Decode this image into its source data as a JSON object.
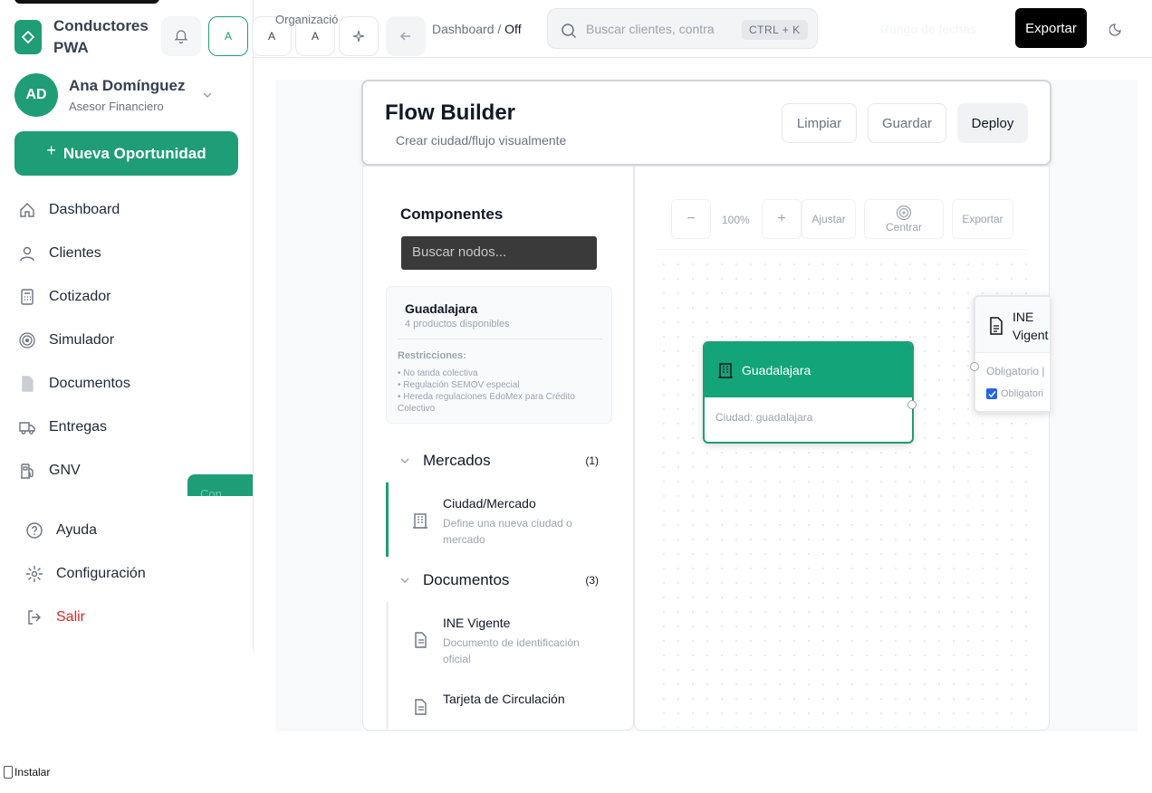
{
  "app": {
    "brand": "Conductores PWA"
  },
  "header_buttons": {
    "a1": "A",
    "a2": "A",
    "a3": "A"
  },
  "user": {
    "initials": "AD",
    "name": "Ana Domínguez",
    "role": "Asesor Financiero"
  },
  "cta": {
    "label": "Nueva Oportunidad"
  },
  "nav": [
    {
      "label": "Dashboard",
      "icon": "home-icon"
    },
    {
      "label": "Clientes",
      "icon": "user-icon"
    },
    {
      "label": "Cotizador",
      "icon": "calculator-icon"
    },
    {
      "label": "Simulador",
      "icon": "target-icon"
    },
    {
      "label": "Documentos",
      "icon": "document-icon"
    },
    {
      "label": "Entregas",
      "icon": "truck-icon"
    },
    {
      "label": "GNV",
      "icon": "fuel-icon"
    }
  ],
  "nav_bottom": [
    {
      "label": "Ayuda",
      "icon": "help-icon"
    },
    {
      "label": "Configuración",
      "icon": "settings-icon"
    },
    {
      "label": "Salir",
      "icon": "logout-icon",
      "color": "#dc2626"
    }
  ],
  "green_tab": {
    "label": "Con"
  },
  "header": {
    "org_label": "Organizació",
    "breadcrumb_parent": "Dashboard /",
    "breadcrumb_current": "Off",
    "search_placeholder": "Buscar clientes, contra",
    "search_shortcut": "CTRL + K",
    "date_range": "Rango de fechas",
    "export_label": "Exportar"
  },
  "flow_builder": {
    "title": "Flow Builder",
    "subtitle": "Crear ciudad/flujo visualmente",
    "buttons": {
      "clear": "Limpiar",
      "save": "Guardar",
      "deploy": "Deploy"
    }
  },
  "components_panel": {
    "title": "Componentes",
    "search_placeholder": "Buscar nodos...",
    "city_card": {
      "name": "Guadalajara",
      "count": "4 productos disponibles",
      "restrictions_title": "Restricciones:",
      "restrictions": [
        "• No tanda colectiva",
        "• Regulación SEMOV especial",
        "• Hereda regulaciones EdoMex para Crédito Colectivo"
      ]
    },
    "sections": [
      {
        "label": "Mercados",
        "count": "(1)",
        "items": [
          {
            "name": "Ciudad/Mercado",
            "desc": "Define una nueva ciudad o mercado",
            "icon": "building-icon"
          }
        ]
      },
      {
        "label": "Documentos",
        "count": "(3)",
        "items": [
          {
            "name": "INE Vigente",
            "desc": "Documento de identificación oficial",
            "icon": "document-icon"
          },
          {
            "name": "Tarjeta de Circulación",
            "desc": "",
            "icon": "document-icon"
          }
        ]
      }
    ]
  },
  "canvas": {
    "zoom_out": "−",
    "zoom_level": "100%",
    "zoom_in": "+",
    "fit": "Ajustar",
    "center": "Centrar",
    "export": "Exportar",
    "nodes": {
      "city": {
        "title": "Guadalajara",
        "body": "Ciudad: guadalajara"
      },
      "ine": {
        "title": "INE Vigent",
        "req_label": "Obligatorio |",
        "check_label": "Obligatori"
      }
    }
  },
  "install": {
    "label": "Instalar"
  },
  "colors": {
    "accent": "#1f9d76",
    "node_header": "#13a47a",
    "danger": "#dc2626"
  }
}
